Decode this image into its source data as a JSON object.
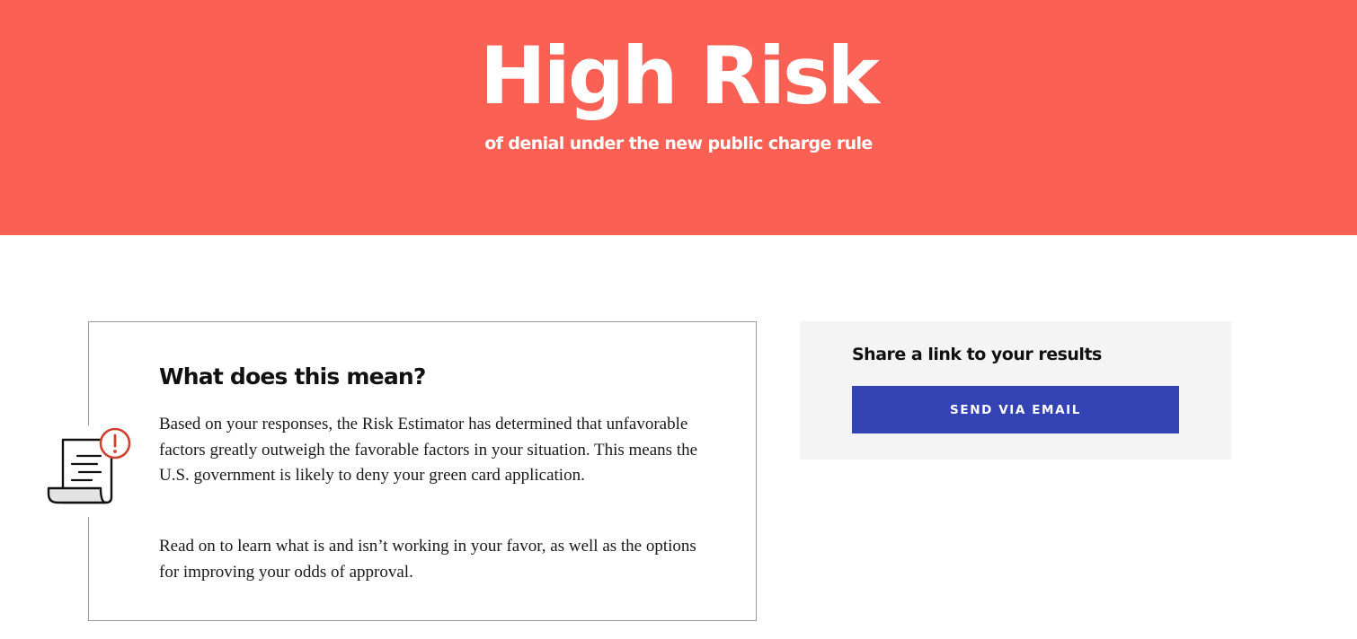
{
  "hero": {
    "title": "High Risk",
    "subtitle": "of denial under the new public charge rule",
    "background_color": "#fa6053"
  },
  "explanation": {
    "icon": "document-warning-icon",
    "heading": "What does this mean?",
    "paragraphs": [
      "Based on your responses, the Risk Estimator has determined that unfavorable factors greatly outweigh the favorable factors in your situation. This means the U.S. government is likely to deny your green card application.",
      "Read on to learn what is and isn’t working in your favor, as well as the options for improving your odds of approval."
    ]
  },
  "share": {
    "heading": "Share a link to your results",
    "button_label": "SEND VIA EMAIL",
    "button_color": "#3443b4"
  },
  "colors": {
    "warning_accent": "#d2402f",
    "panel_background": "#f4f4f4"
  }
}
